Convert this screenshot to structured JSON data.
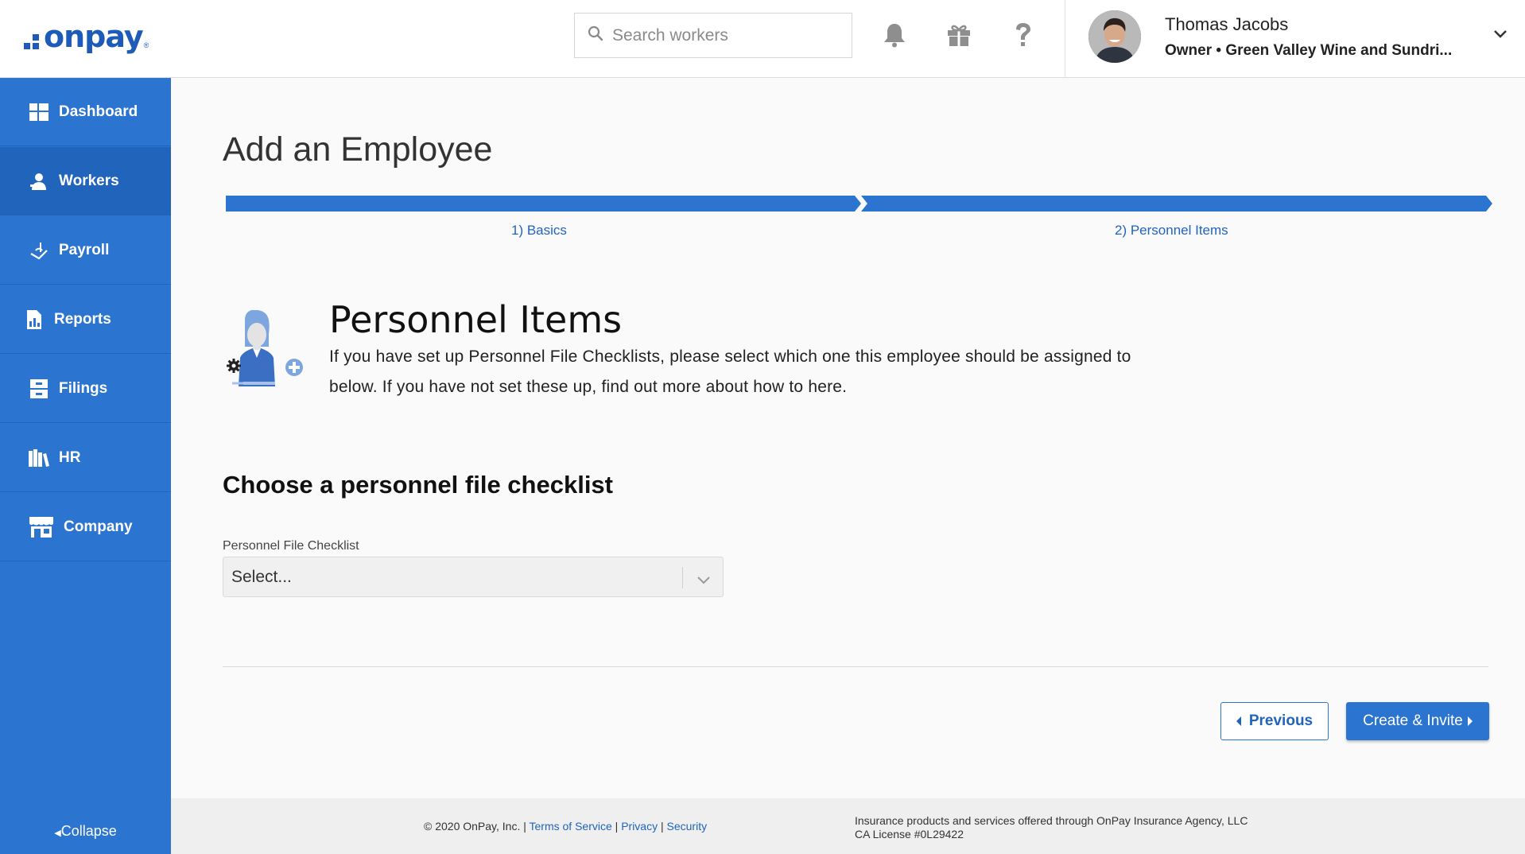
{
  "header": {
    "logo_text": "onpay",
    "logo_mark": "®",
    "search_placeholder": "Search workers",
    "user_name": "Thomas Jacobs",
    "user_role": "Owner • Green Valley Wine and Sundri...",
    "icons": [
      "bell-icon",
      "gift-icon",
      "help-icon",
      "chevron-down-icon"
    ]
  },
  "sidebar": {
    "items": [
      {
        "label": "Dashboard",
        "icon": "dashboard-icon"
      },
      {
        "label": "Workers",
        "icon": "workers-icon",
        "active": true
      },
      {
        "label": "Payroll",
        "icon": "payroll-icon"
      },
      {
        "label": "Reports",
        "icon": "reports-icon"
      },
      {
        "label": "Filings",
        "icon": "filings-icon"
      },
      {
        "label": "HR",
        "icon": "hr-icon"
      },
      {
        "label": "Company",
        "icon": "company-icon"
      }
    ],
    "collapse_label": "Collapse"
  },
  "main": {
    "page_title": "Add an Employee",
    "steps": [
      {
        "label": "1) Basics"
      },
      {
        "label": "2) Personnel Items"
      }
    ],
    "section_title": "Personnel Items",
    "section_desc": "If you have set up Personnel File Checklists, please select which one this employee should be assigned to below. If you have not set these up, find out more about how to here.",
    "choose_title": "Choose a personnel file checklist",
    "field_label": "Personnel File Checklist",
    "select_value": "Select...",
    "previous_label": "Previous",
    "next_label": "Create & Invite"
  },
  "footer": {
    "copyright": "© 2020 OnPay, Inc. |",
    "terms": "Terms of Service",
    "sep1": "|",
    "privacy": "Privacy",
    "sep2": "|",
    "security": "Security",
    "insurance_line1": "Insurance products and services offered through OnPay Insurance Agency, LLC",
    "insurance_line2": "CA License #0L29422"
  },
  "colors": {
    "brand_blue": "#2b75d1",
    "brand_dark": "#2164bc",
    "text": "#222222"
  }
}
